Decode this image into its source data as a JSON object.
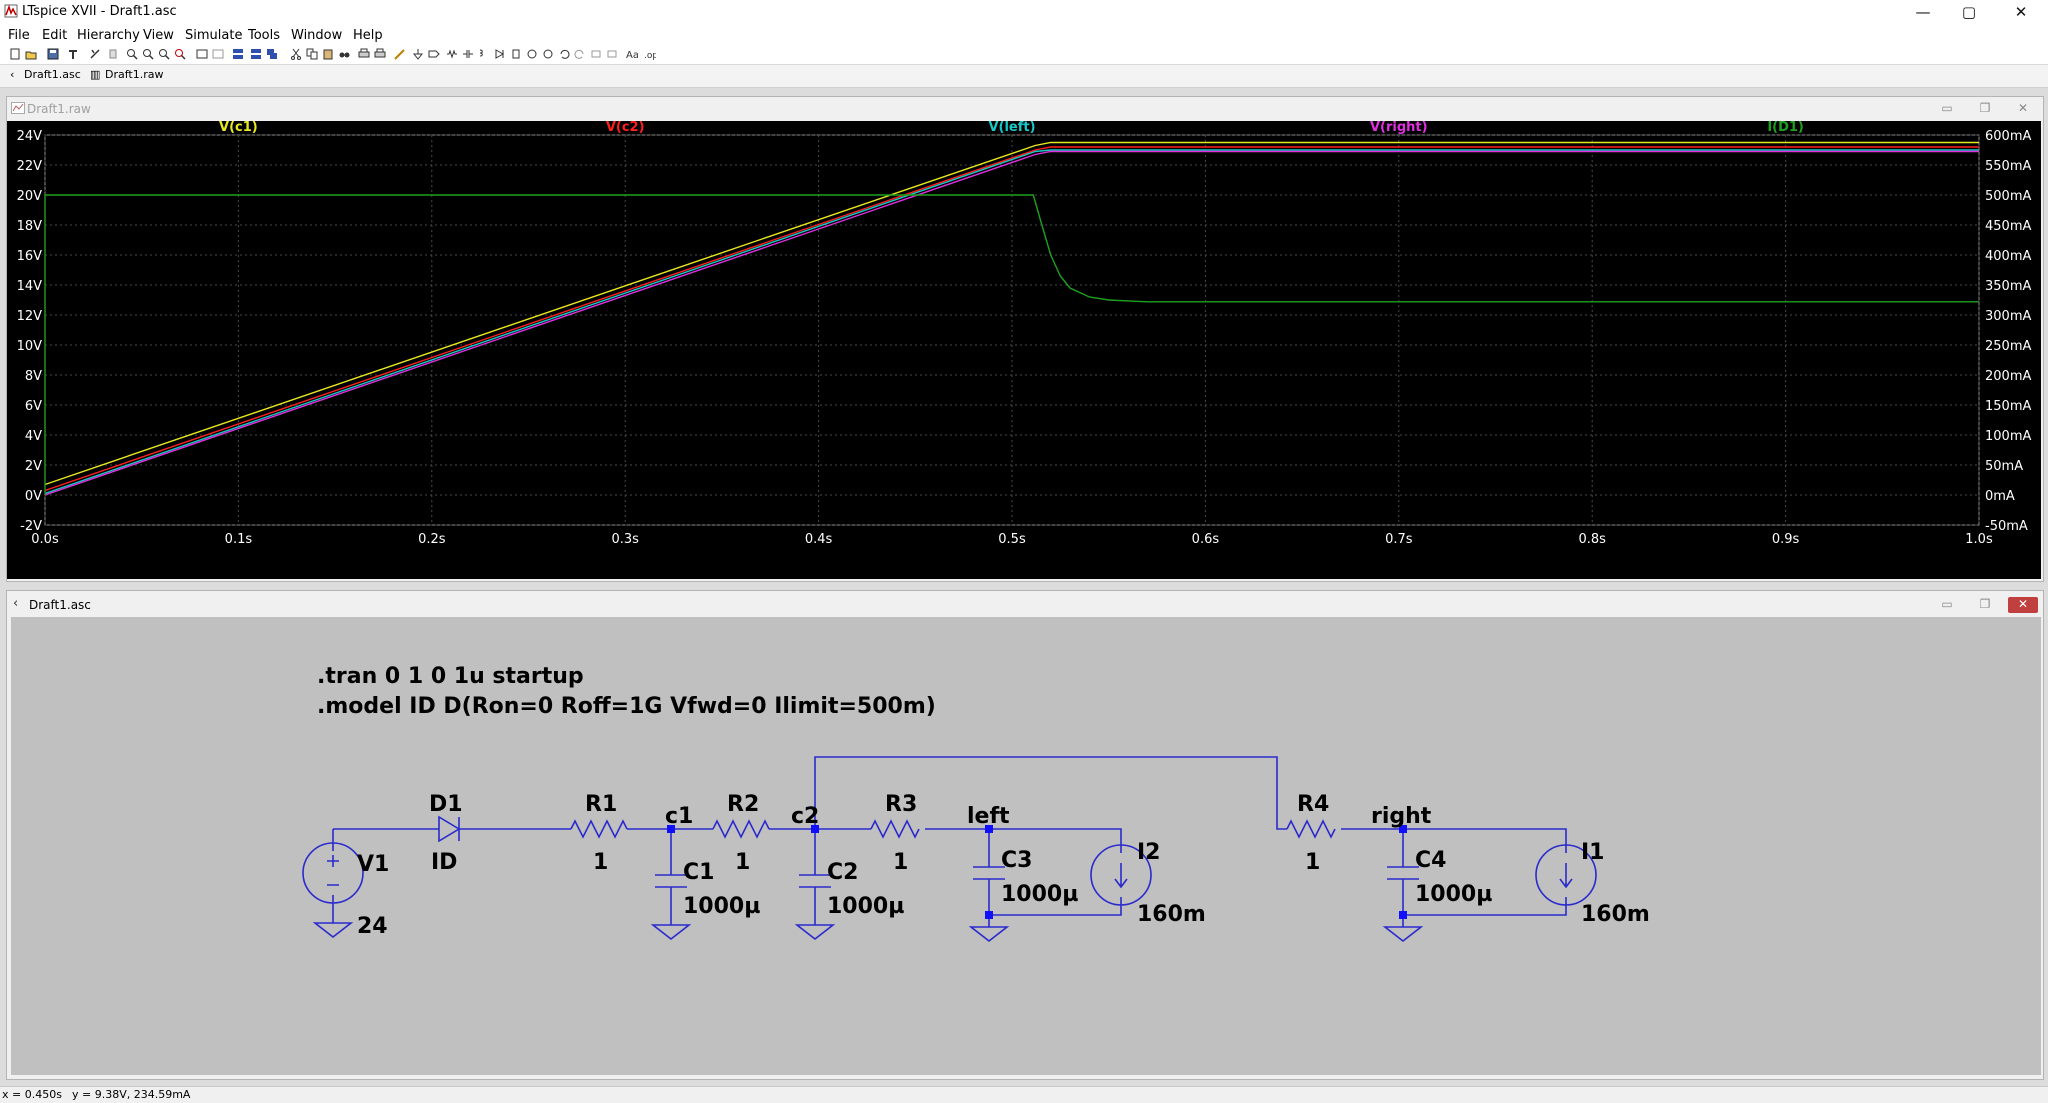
{
  "app": {
    "title": "LTspice XVII - Draft1.asc",
    "icon": "ltspice-app-icon",
    "window_controls": {
      "minimize": "—",
      "maximize": "▢",
      "close": "✕"
    }
  },
  "menu": [
    "File",
    "Edit",
    "Hierarchy",
    "View",
    "Simulate",
    "Tools",
    "Window",
    "Help"
  ],
  "tabs": [
    {
      "label": "Draft1.asc",
      "icon": "schematic-tab-icon"
    },
    {
      "label": "Draft1.raw",
      "icon": "waveform-tab-icon"
    }
  ],
  "plot_window": {
    "title": "Draft1.raw",
    "background": "#000000",
    "grid_color": "#4a4a4a",
    "axis_text_color": "#ffffff"
  },
  "chart_data": {
    "type": "line",
    "x_unit": "s",
    "xlim": [
      0.0,
      1.0
    ],
    "x_ticks": [
      "0.0s",
      "0.1s",
      "0.2s",
      "0.3s",
      "0.4s",
      "0.5s",
      "0.6s",
      "0.7s",
      "0.8s",
      "0.9s",
      "1.0s"
    ],
    "x_tick_values": [
      0.0,
      0.1,
      0.2,
      0.3,
      0.4,
      0.5,
      0.6,
      0.7,
      0.8,
      0.9,
      1.0
    ],
    "left_axis": {
      "ylim": [
        -2,
        24
      ],
      "ticks": [
        "24V",
        "22V",
        "20V",
        "18V",
        "16V",
        "14V",
        "12V",
        "10V",
        "8V",
        "6V",
        "4V",
        "2V",
        "0V",
        "-2V"
      ],
      "tick_values": [
        24,
        22,
        20,
        18,
        16,
        14,
        12,
        10,
        8,
        6,
        4,
        2,
        0,
        -2
      ]
    },
    "right_axis": {
      "ylim": [
        -50,
        600
      ],
      "ticks": [
        "600mA",
        "550mA",
        "500mA",
        "450mA",
        "400mA",
        "350mA",
        "300mA",
        "250mA",
        "200mA",
        "150mA",
        "100mA",
        "50mA",
        "0mA",
        "-50mA"
      ],
      "tick_values": [
        600,
        550,
        500,
        450,
        400,
        350,
        300,
        250,
        200,
        150,
        100,
        50,
        0,
        -50
      ]
    },
    "grid": true,
    "series": [
      {
        "name": "V(c1)",
        "color": "#e8e820",
        "axis": "left",
        "x": [
          0.0,
          0.512,
          0.52,
          1.0
        ],
        "y": [
          0.7,
          23.3,
          23.5,
          23.5
        ]
      },
      {
        "name": "V(c2)",
        "color": "#ff1f1f",
        "axis": "left",
        "x": [
          0.0,
          0.512,
          0.52,
          1.0
        ],
        "y": [
          0.3,
          23.0,
          23.2,
          23.2
        ]
      },
      {
        "name": "V(left)",
        "color": "#19c8c8",
        "axis": "left",
        "x": [
          0.0,
          0.512,
          0.52,
          1.0
        ],
        "y": [
          0.1,
          22.9,
          23.0,
          23.0
        ]
      },
      {
        "name": "V(right)",
        "color": "#e030e0",
        "axis": "left",
        "x": [
          0.0,
          0.512,
          0.52,
          1.0
        ],
        "y": [
          0.0,
          22.7,
          22.9,
          22.9
        ]
      },
      {
        "name": "I(D1)",
        "color": "#1ea01e",
        "axis": "right",
        "x": [
          0.0,
          0.0,
          0.511,
          0.515,
          0.52,
          0.525,
          0.53,
          0.54,
          0.55,
          0.57,
          1.0
        ],
        "y": [
          0,
          500,
          500,
          455,
          400,
          365,
          345,
          330,
          325,
          322,
          322
        ]
      }
    ]
  },
  "schematic_window": {
    "title": "Draft1.asc",
    "background": "#c0c0c0",
    "wire_color": "#2a2acd",
    "component_color": "#2a2acd",
    "directives": [
      ".tran 0 1 0 1u startup",
      ".model ID D(Ron=0 Roff=1G Vfwd=0 Ilimit=500m)"
    ],
    "labels": {
      "V1": "V1",
      "V1_value": "24",
      "D1": "D1",
      "D1_model": "ID",
      "R1": "R1",
      "R1_value": "1",
      "R2": "R2",
      "R2_value": "1",
      "R3": "R3",
      "R3_value": "1",
      "R4": "R4",
      "R4_value": "1",
      "C1": "C1",
      "C1_value": "1000µ",
      "C2": "C2",
      "C2_value": "1000µ",
      "C3": "C3",
      "C3_value": "1000µ",
      "C4": "C4",
      "C4_value": "1000µ",
      "I1": "I1",
      "I1_value": "160m",
      "I2": "I2",
      "I2_value": "160m",
      "net_c1": "c1",
      "net_c2": "c2",
      "net_left": "left",
      "net_right": "right"
    }
  },
  "status": {
    "x": "x = 0.450s",
    "y": "y = 9.38V, 234.59mA"
  }
}
